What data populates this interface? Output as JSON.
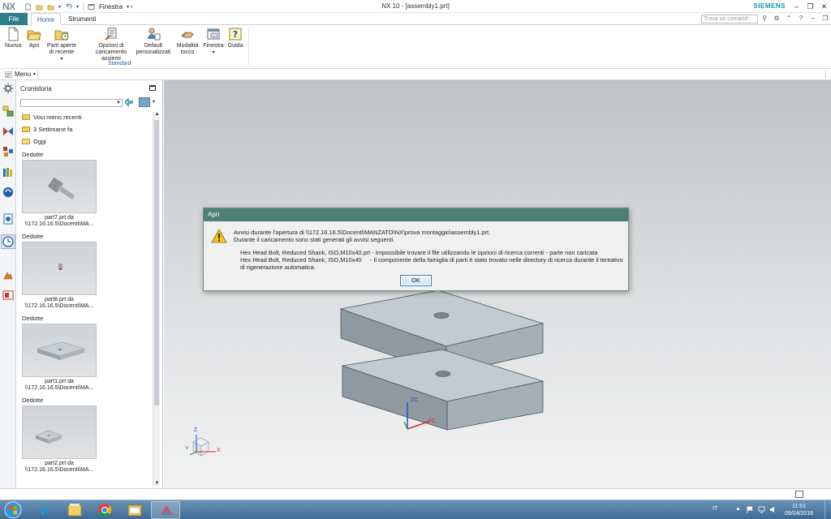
{
  "app": {
    "logo": "NX",
    "title": "NX 10 - [assembly1.prt]",
    "brand": "SIEMENS",
    "window_menu": "Finestra"
  },
  "tabs": [
    {
      "label": "File"
    },
    {
      "label": "Home"
    },
    {
      "label": "Strumenti"
    }
  ],
  "search": {
    "placeholder": "Trova un comand"
  },
  "ribbon": {
    "group_label": "Standard",
    "buttons": [
      {
        "label": "Nuova",
        "icon": "new-document-icon"
      },
      {
        "label": "Apri",
        "icon": "open-folder-icon"
      },
      {
        "label": "Parti aperte di recente",
        "icon": "recent-parts-icon"
      },
      {
        "label": "Opzioni di caricamento assiemi",
        "icon": "load-options-icon"
      },
      {
        "label": "Default personalizzati",
        "icon": "user-defaults-icon"
      },
      {
        "label": "Modalità tocco",
        "icon": "touch-mode-icon"
      },
      {
        "label": "Finestra",
        "icon": "window-icon"
      },
      {
        "label": "Guida",
        "icon": "help-icon"
      }
    ]
  },
  "menubar": {
    "menu_label": "Menu"
  },
  "history": {
    "title": "Cronistoria",
    "folders": [
      {
        "label": "Voci meno recenti"
      },
      {
        "label": "3 Settimane fa"
      },
      {
        "label": "Oggi"
      }
    ],
    "entries": [
      {
        "group": "Dedotte",
        "name": "part7.prt da",
        "path": "\\\\172.16.16.5\\Docenti\\MA..."
      },
      {
        "group": "Dedotte",
        "name": "part8.prt da",
        "path": "\\\\172.16.16.5\\Docenti\\MA..."
      },
      {
        "group": "Dedotte",
        "name": "part1.prt da",
        "path": "\\\\172.16.16.5\\Docenti\\MA..."
      },
      {
        "group": "Dedotte",
        "name": "part2.prt da",
        "path": "\\\\172.16.16.5\\Docenti\\MA..."
      }
    ]
  },
  "dialog": {
    "title": "Apri",
    "line1": "Avvisi durante l'apertura di \\\\172.16.16.5\\Docenti\\MANZATO\\NX\\prova montaggio\\assembly1.prt.",
    "line2": "Durante il caricamento sono stati generati gli avvisi seguenti.",
    "warning1": "Hex Head Bolt, Reduced Shank, ISO,M10x40.prt - Impossibile trovare il file utilizzando le opzioni di ricerca correnti - parte non caricata",
    "warning2": "Hex Head Bolt, Reduced Shank, ISO,M10x40     - Il componente della famiglia di parti è stato trovato nelle directory di ricerca durante il tentativo di rigenerazione automatica.",
    "ok_label": "OK"
  },
  "viewport": {
    "axis_labels": {
      "x": "X",
      "y": "Y",
      "z": "Z",
      "xc": "XC",
      "zc": "ZC"
    }
  },
  "taskbar": {
    "language": "IT",
    "time": "11:51",
    "date": "09/04/2016"
  },
  "colors": {
    "accent": "#2f7d8c",
    "dialog_title": "#4f7f73",
    "brand": "#089aa5"
  }
}
